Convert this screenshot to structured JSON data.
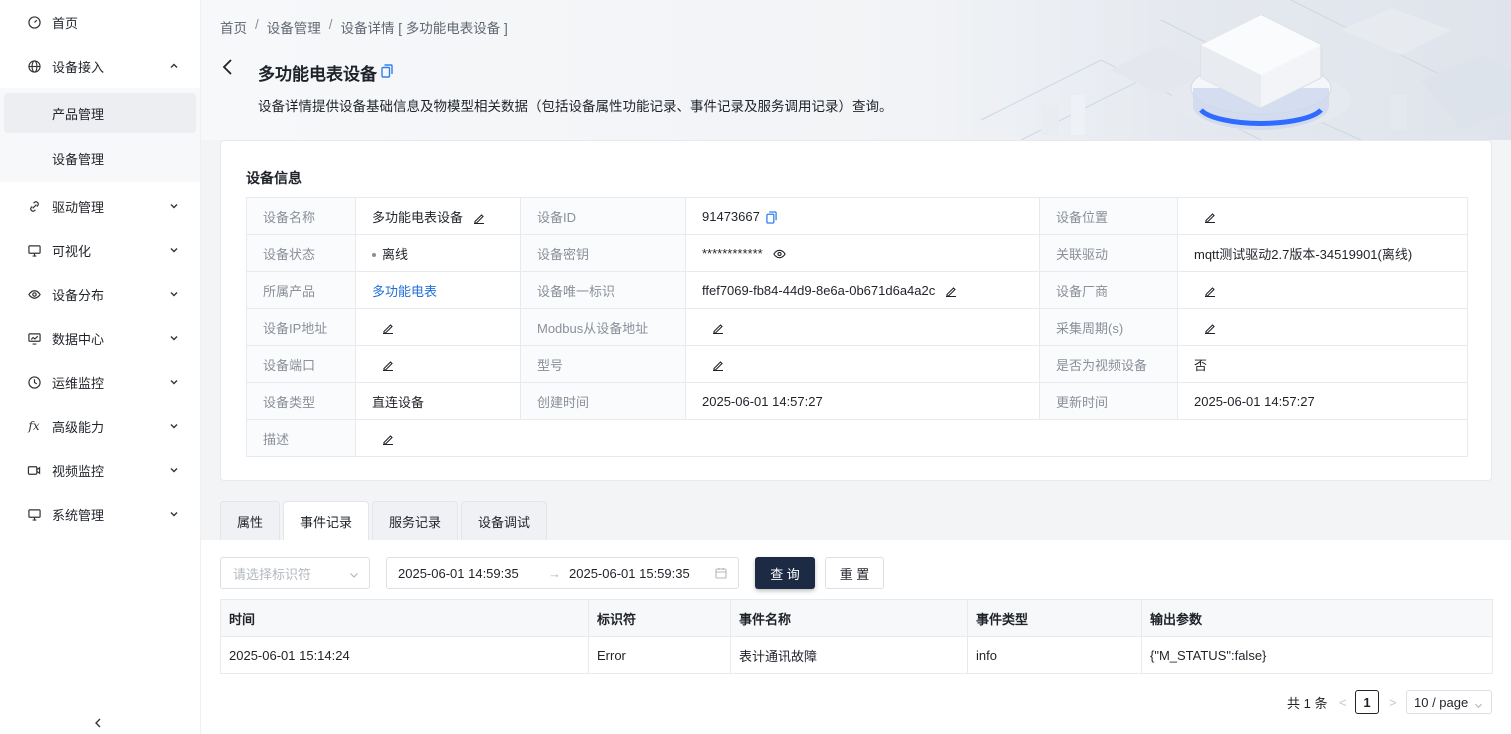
{
  "sidebar": {
    "items": [
      {
        "label": "首页",
        "icon": "dashboard-icon"
      },
      {
        "label": "设备接入",
        "icon": "globe-icon"
      },
      {
        "label": "驱动管理",
        "icon": "link-icon"
      },
      {
        "label": "可视化",
        "icon": "monitor-icon"
      },
      {
        "label": "设备分布",
        "icon": "eye-icon"
      },
      {
        "label": "数据中心",
        "icon": "chart-monitor-icon"
      },
      {
        "label": "运维监控",
        "icon": "clock-icon"
      },
      {
        "label": "高级能力",
        "icon": "fx-icon"
      },
      {
        "label": "视频监控",
        "icon": "video-icon"
      },
      {
        "label": "系统管理",
        "icon": "desktop-icon"
      }
    ],
    "sub_items": [
      {
        "label": "产品管理",
        "active": true
      },
      {
        "label": "设备管理",
        "active": false
      }
    ]
  },
  "breadcrumb": [
    "首页",
    "设备管理",
    "设备详情 [ 多功能电表设备 ]"
  ],
  "page": {
    "title": "多功能电表设备",
    "description": "设备详情提供设备基础信息及物模型相关数据（包括设备属性功能记录、事件记录及服务调用记录）查询。"
  },
  "info_card": {
    "title": "设备信息",
    "rows": [
      [
        {
          "k": "设备名称",
          "v": "多功能电表设备"
        },
        {
          "k": "设备ID",
          "v": "91473667"
        },
        {
          "k": "设备位置",
          "v": ""
        }
      ],
      [
        {
          "k": "设备状态",
          "v": "离线"
        },
        {
          "k": "设备密钥",
          "v": "************"
        },
        {
          "k": "关联驱动",
          "v": "mqtt测试驱动2.7版本-34519901(离线)"
        }
      ],
      [
        {
          "k": "所属产品",
          "v": "多功能电表"
        },
        {
          "k": "设备唯一标识",
          "v": "ffef7069-fb84-44d9-8e6a-0b671d6a4a2c"
        },
        {
          "k": "设备厂商",
          "v": ""
        }
      ],
      [
        {
          "k": "设备IP地址",
          "v": ""
        },
        {
          "k": "Modbus从设备地址",
          "v": ""
        },
        {
          "k": "采集周期(s)",
          "v": ""
        }
      ],
      [
        {
          "k": "设备端口",
          "v": ""
        },
        {
          "k": "型号",
          "v": ""
        },
        {
          "k": "是否为视频设备",
          "v": "否"
        }
      ],
      [
        {
          "k": "设备类型",
          "v": "直连设备"
        },
        {
          "k": "创建时间",
          "v": "2025-06-01 14:57:27"
        },
        {
          "k": "更新时间",
          "v": "2025-06-01 14:57:27"
        }
      ],
      [
        {
          "k": "描述",
          "v": ""
        }
      ]
    ]
  },
  "tabs": [
    "属性",
    "事件记录",
    "服务记录",
    "设备调试"
  ],
  "active_tab": "事件记录",
  "filters": {
    "select_placeholder": "请选择标识符",
    "start": "2025-06-01 14:59:35",
    "arrow": "→",
    "end": "2025-06-01 15:59:35",
    "query_label": "查 询",
    "reset_label": "重 置"
  },
  "events": {
    "columns": [
      "时间",
      "标识符",
      "事件名称",
      "事件类型",
      "输出参数"
    ],
    "rows": [
      [
        "2025-06-01 15:14:24",
        "Error",
        "表计通讯故障",
        "info",
        "{\"M_STATUS\":false}"
      ]
    ]
  },
  "pagination": {
    "total": "共 1 条",
    "prev": "<",
    "page": "1",
    "next": ">",
    "page_size": "10 / page"
  },
  "colors": {
    "link": "#1f6fd8",
    "primary_button": "#1d2a44",
    "copy_icon": "#2f80ed"
  }
}
